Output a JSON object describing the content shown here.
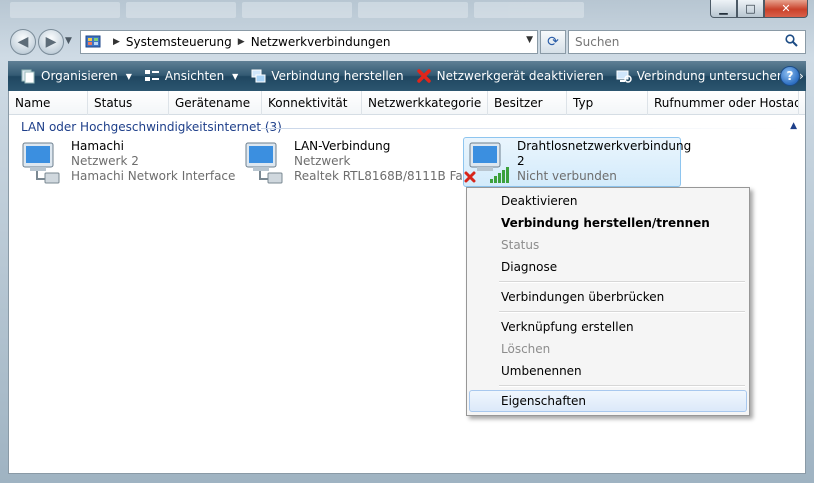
{
  "window": {
    "caption_buttons": {
      "minimize": "▁",
      "maximize": "□",
      "close": "✕"
    }
  },
  "nav": {
    "back_icon": "back-arrow-icon",
    "forward_icon": "forward-arrow-icon",
    "breadcrumb": [
      "Systemsteuerung",
      "Netzwerkverbindungen"
    ],
    "search_placeholder": "Suchen"
  },
  "toolbar": {
    "items": [
      {
        "label": "Organisieren",
        "icon": "organize-icon",
        "dropdown": true
      },
      {
        "label": "Ansichten",
        "icon": "views-icon",
        "dropdown": true
      },
      {
        "label": "Verbindung herstellen",
        "icon": "connect-icon",
        "dropdown": false
      },
      {
        "label": "Netzwerkgerät deaktivieren",
        "icon": "disable-x-icon",
        "dropdown": false
      },
      {
        "label": "Verbindung untersuchen",
        "icon": "diagnose-icon",
        "dropdown": false
      }
    ],
    "more": "»",
    "help": "?"
  },
  "columns": [
    "Name",
    "Status",
    "Gerätename",
    "Konnektivität",
    "Netzwerkkategorie",
    "Besitzer",
    "Typ",
    "Rufnummer oder Hostad..."
  ],
  "group": {
    "title": "LAN oder Hochgeschwindigkeitsinternet (3)"
  },
  "connections": [
    {
      "name": "Hamachi",
      "status": "Netzwerk  2",
      "device": "Hamachi Network Interface"
    },
    {
      "name": "LAN-Verbindung",
      "status": "Netzwerk",
      "device": "Realtek RTL8168B/8111B Fa..."
    },
    {
      "name": "Drahtlosnetzwerkverbindung",
      "name_line2": "2",
      "status": "Nicht verbunden"
    }
  ],
  "context_menu": {
    "items": [
      {
        "label": "Deaktivieren",
        "style": "normal"
      },
      {
        "label": "Verbindung herstellen/trennen",
        "style": "bold"
      },
      {
        "label": "Status",
        "style": "disabled"
      },
      {
        "label": "Diagnose",
        "style": "normal"
      },
      {
        "label": "Verbindungen überbrücken",
        "style": "normal"
      },
      {
        "label": "Verknüpfung erstellen",
        "style": "normal"
      },
      {
        "label": "Löschen",
        "style": "disabled"
      },
      {
        "label": "Umbenennen",
        "style": "normal"
      },
      {
        "label": "Eigenschaften",
        "style": "highlighted"
      }
    ]
  },
  "colors": {
    "toolbar": "#2c5670",
    "group_text": "#1e3f8a",
    "selection": "#d3ebfb",
    "disabled_text": "#8d8d8d"
  }
}
